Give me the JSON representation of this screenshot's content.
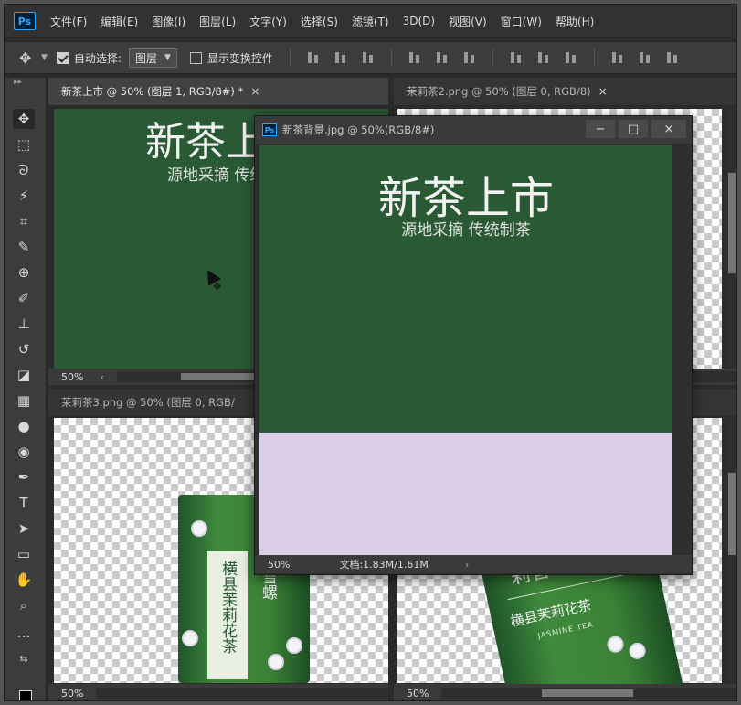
{
  "app": {
    "logo": "Ps"
  },
  "menu": [
    "文件(F)",
    "编辑(E)",
    "图像(I)",
    "图层(L)",
    "文字(Y)",
    "选择(S)",
    "滤镜(T)",
    "3D(D)",
    "视图(V)",
    "窗口(W)",
    "帮助(H)"
  ],
  "options": {
    "auto_select_label": "自动选择:",
    "auto_select_checked": true,
    "auto_select_target": "图层",
    "show_transform_label": "显示变换控件",
    "show_transform_checked": false
  },
  "tools": [
    "move-tool-icon",
    "marquee-tool-icon",
    "lasso-tool-icon",
    "magic-wand-icon",
    "crop-tool-icon",
    "eyedropper-icon",
    "healing-brush-icon",
    "brush-tool-icon",
    "clone-stamp-icon",
    "history-brush-icon",
    "eraser-icon",
    "gradient-tool-icon",
    "blur-tool-icon",
    "dodge-tool-icon",
    "pen-tool-icon",
    "type-tool-icon",
    "path-select-icon",
    "rectangle-tool-icon",
    "hand-tool-icon",
    "zoom-tool-icon",
    "more-tools-icon"
  ],
  "docs": {
    "top_left": {
      "tab": "新茶上市 @ 50% (图层 1, RGB/8#) *",
      "close": "×",
      "zoom": "50%",
      "title": "新茶上市",
      "subtitle": "源地采摘 传统制茶"
    },
    "top_right": {
      "tab": "茉莉茶2.png @ 50% (图层 0, RGB/8)",
      "close": "×"
    },
    "bottom_left": {
      "tab": "茉莉茶3.png @ 50% (图层 0, RGB/",
      "zoom": "50%",
      "can_text_1": "横县茉莉花茶",
      "can_text_2": "碧雪螺"
    },
    "bottom_right": {
      "zoom": "50%",
      "can_text_top": "莉香",
      "can_text_main": "横县茉莉花茶",
      "can_text_en": "JASMINE TEA"
    }
  },
  "float_window": {
    "title": "新茶背景.jpg @ 50%(RGB/8#)",
    "minimize": "−",
    "maximize": "□",
    "close": "×",
    "headline": "新茶上市",
    "subline": "源地采摘 传统制茶",
    "zoom": "50%",
    "doc_info": "文档:1.83M/1.61M",
    "top_color": "#2a5a34",
    "bottom_color": "#dccfe8"
  }
}
